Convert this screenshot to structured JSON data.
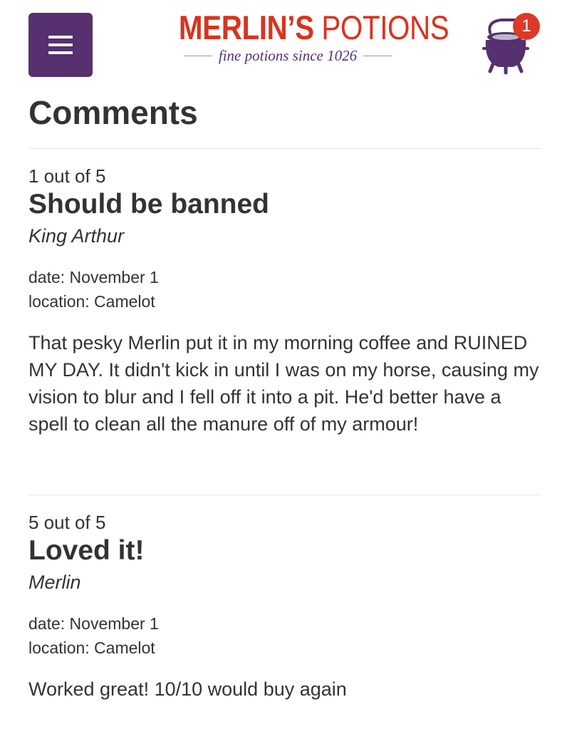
{
  "header": {
    "menu_icon": "hamburger-menu-icon",
    "logo_title_bold": "MERLIN’S",
    "logo_title_light": " POTIONS",
    "logo_tagline": "fine potions since 1026",
    "cart_icon": "cauldron-cart-icon",
    "cart_count": "1",
    "colors": {
      "menu_bg": "#56306f",
      "logo_red": "#d8341f",
      "cart_purple": "#56306f",
      "badge_red": "#db3a26"
    }
  },
  "page": {
    "title": "Comments"
  },
  "comments": [
    {
      "rating": "1 out of 5",
      "title": "Should be banned",
      "author": "King Arthur",
      "date": "date: November 1",
      "location": "location: Camelot",
      "body": "That pesky Merlin put it in my morning coffee and RUINED MY DAY. It didn't kick in until I was on my horse, causing my vision to blur and I fell off it into a pit. He'd better have a spell to clean all the manure off of my armour!"
    },
    {
      "rating": "5 out of 5",
      "title": "Loved it!",
      "author": "Merlin",
      "date": "date: November 1",
      "location": "location: Camelot",
      "body": "Worked great! 10/10 would buy again"
    }
  ]
}
